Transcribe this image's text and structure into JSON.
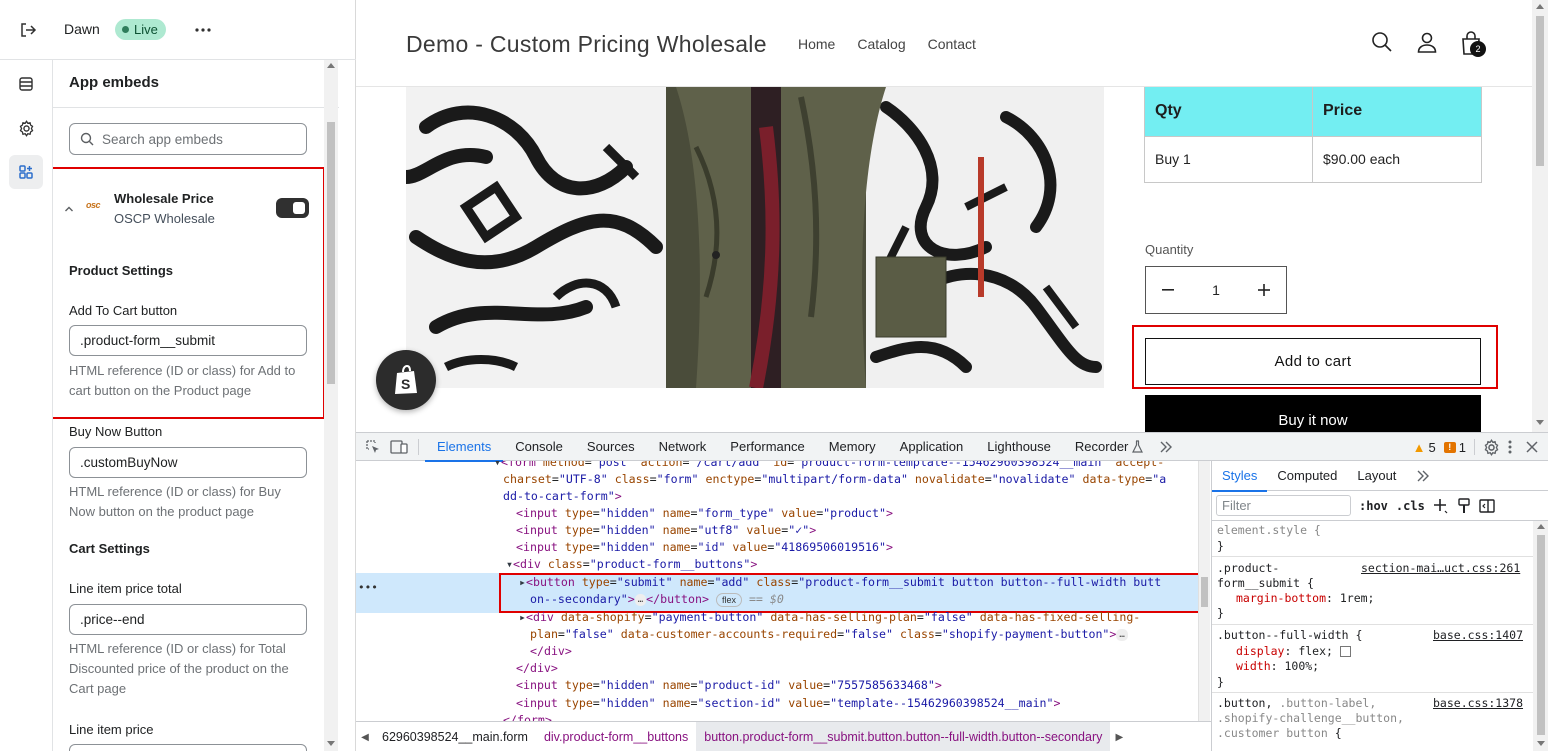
{
  "editor": {
    "theme_name": "Dawn",
    "live_badge": "Live",
    "panel_title": "App embeds",
    "search_placeholder": "Search app embeds",
    "embed": {
      "title": "Wholesale Price",
      "subtitle": "OSCP Wholesale",
      "logo_text": "osc",
      "enabled": true
    },
    "product_settings_heading": "Product Settings",
    "add_to_cart_label": "Add To Cart button",
    "add_to_cart_value": ".product-form__submit",
    "add_to_cart_help": "HTML reference (ID or class) for Add to cart button on the Product page",
    "buy_now_label": "Buy Now Button",
    "buy_now_value": ".customBuyNow",
    "buy_now_help": "HTML reference (ID or class) for Buy Now button on the product page",
    "cart_settings_heading": "Cart Settings",
    "line_total_label": "Line item price total",
    "line_total_value": ".price--end",
    "line_total_help": "HTML reference (ID or class) for Total Discounted price of the product on the Cart page",
    "line_price_label": "Line item price"
  },
  "store": {
    "name": "Demo - Custom Pricing Wholesale",
    "nav": [
      "Home",
      "Catalog",
      "Contact"
    ],
    "cart_count": "2",
    "table_headers": [
      "Qty",
      "Price"
    ],
    "table_rows": [
      [
        "Buy 1",
        "$90.00 each"
      ]
    ],
    "quantity_label": "Quantity",
    "quantity_value": "1",
    "add_to_cart": "Add to cart",
    "buy_now": "Buy it now"
  },
  "devtools": {
    "tabs": [
      "Elements",
      "Console",
      "Sources",
      "Network",
      "Performance",
      "Memory",
      "Application",
      "Lighthouse",
      "Recorder"
    ],
    "warnings": "5",
    "issues": "1",
    "breadcrumbs": [
      "62960398524__main.form",
      "div.product-form__buttons",
      "button.product-form__submit.button.button--full-width.button--secondary"
    ],
    "styles_tabs": [
      "Styles",
      "Computed",
      "Layout"
    ],
    "filter_placeholder": "Filter",
    "hov": ":hov",
    "cls": ".cls",
    "dom_dots": "…",
    "dollar": "== $0",
    "flex_pill": "flex"
  },
  "colors": {
    "table_header": "#73eef2",
    "highlight_red": "#e00000",
    "devtools_blue": "#1a73e8",
    "live_green": "#aee9d1"
  }
}
